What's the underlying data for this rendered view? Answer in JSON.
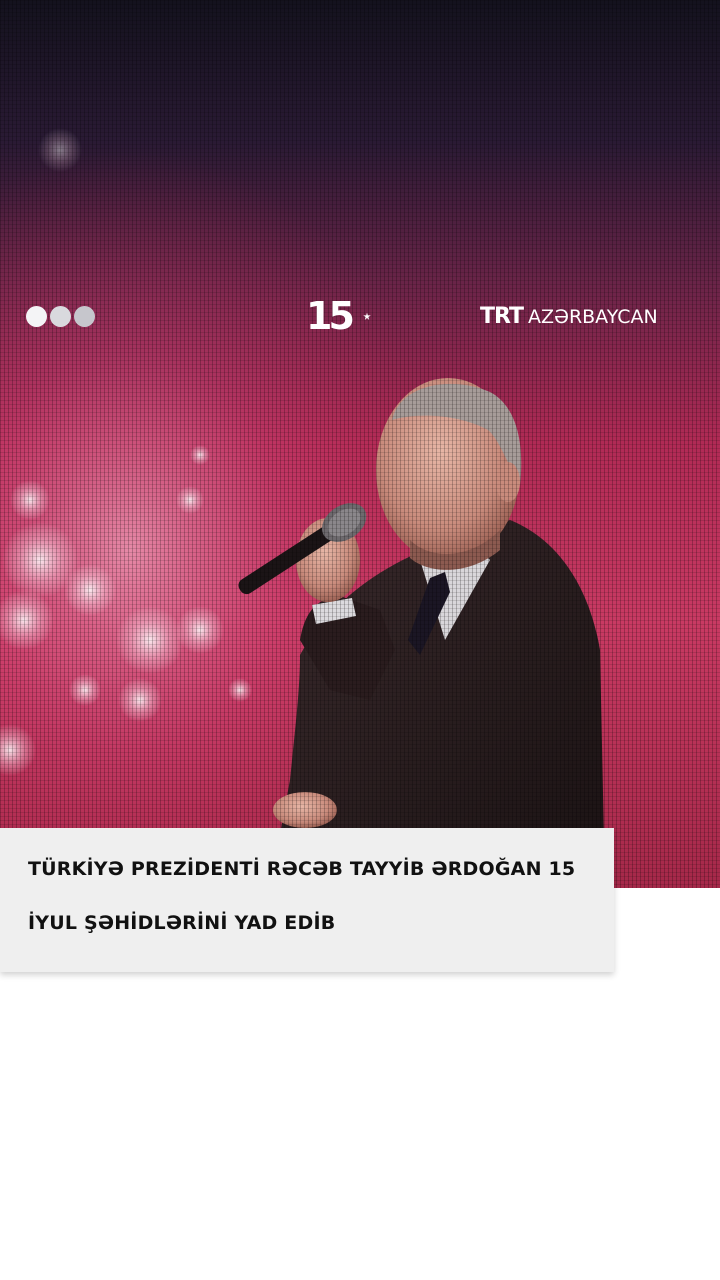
{
  "overlay": {
    "anniversary_number": "15",
    "brand_trt": "TRT",
    "brand_rest": "AZƏRBAYCAN"
  },
  "caption": {
    "headline": "TÜRKİYƏ PREZİDENTİ RƏCƏB TAYYİB ƏRDOĞAN 15 İYUL ŞƏHİDLƏRİNİ YAD EDİB"
  },
  "colors": {
    "caption_background": "#efefef",
    "caption_text": "#111111",
    "stage_background_top": "#12101c",
    "stage_background_glow": "#c22852",
    "page_background": "#ffffff"
  },
  "icons": {
    "dots": "three-dots-icon",
    "anniversary": "crescent-star-icon"
  }
}
